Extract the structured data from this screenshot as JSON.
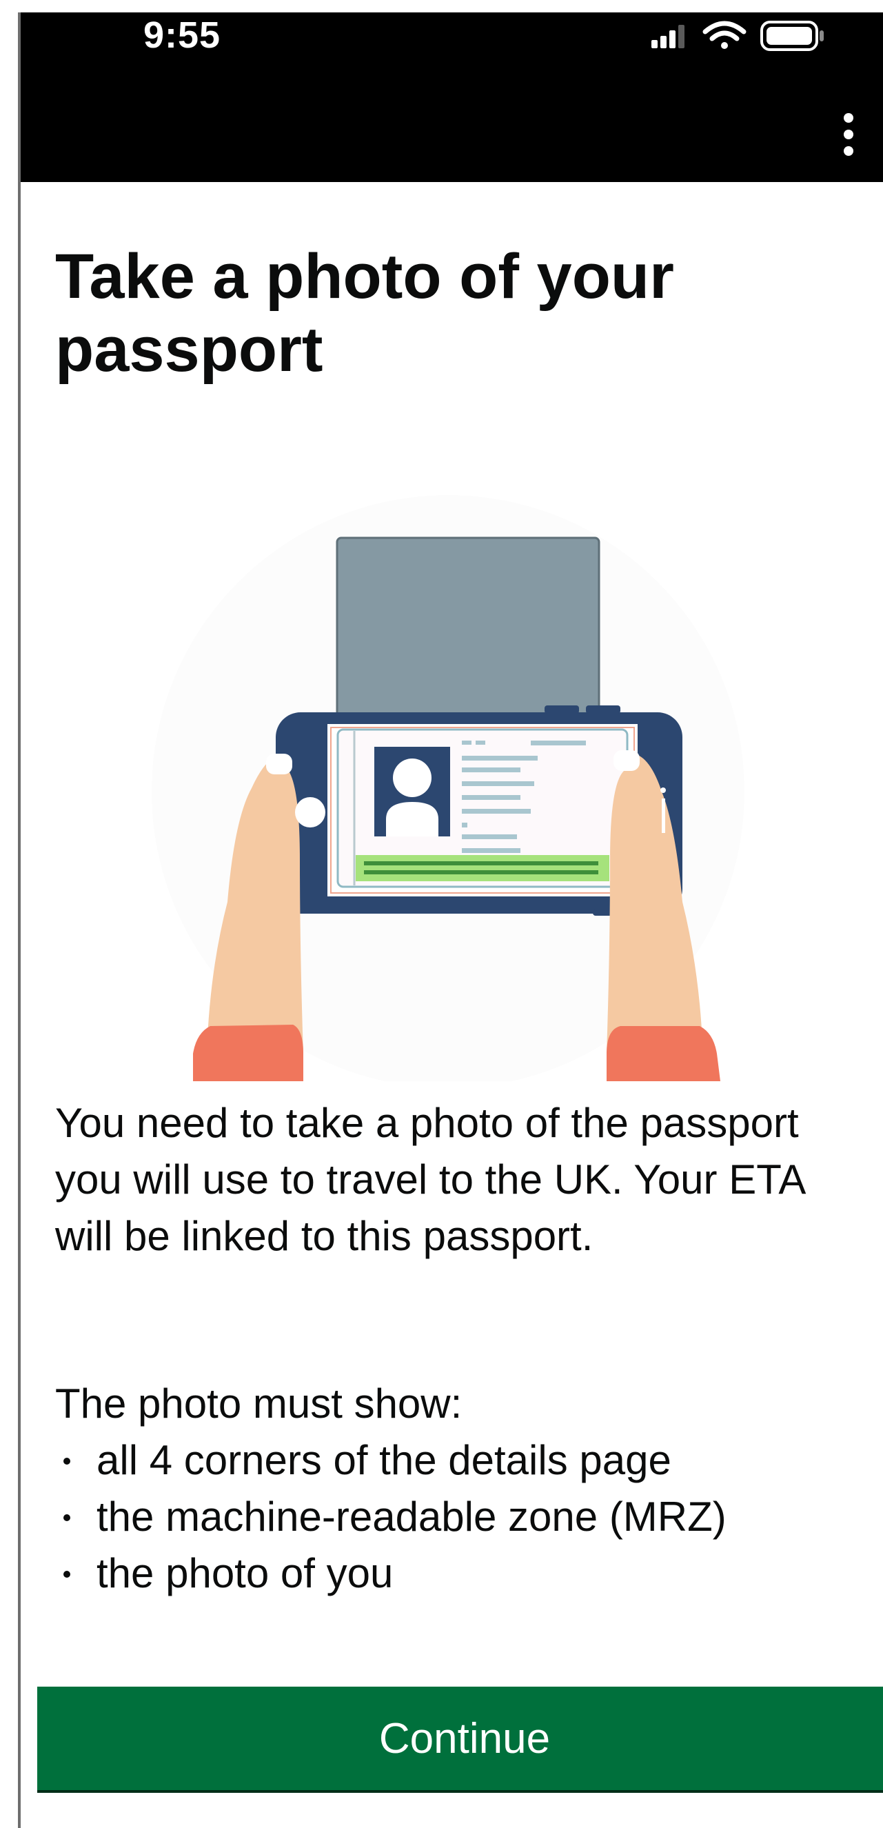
{
  "status_bar": {
    "time": "9:55",
    "icons": [
      "signal-icon",
      "wifi-icon",
      "battery-icon"
    ]
  },
  "app_bar": {
    "menu_icon": "more-vertical-icon"
  },
  "page": {
    "title": "Take a photo of your passport",
    "intro": "You need to take a photo of the passport you will use to travel to the UK. Your ETA will be linked to this passport.",
    "requirements_heading": "The photo must show:",
    "requirements": [
      "all 4 corners of the details page",
      "the machine-readable zone (MRZ)",
      "the photo of you"
    ],
    "continue_label": "Continue"
  },
  "colors": {
    "topbar": "#000000",
    "button": "#00703c",
    "text": "#0b0c0c",
    "phone": "#2c4770",
    "passport_cover": "#8599a3",
    "mrz_highlight": "#a6e27c",
    "skin": "#f5c9a2",
    "sleeve": "#f0765c"
  }
}
